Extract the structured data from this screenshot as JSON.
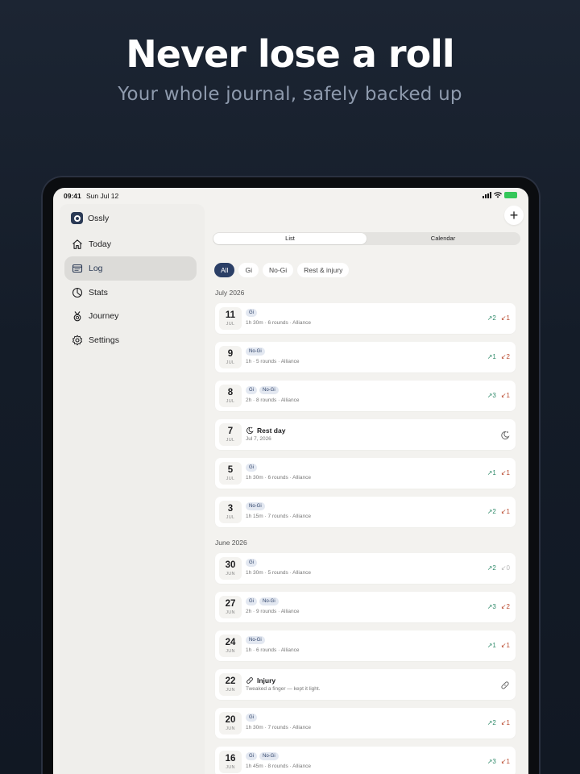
{
  "hero": {
    "title": "Never lose a roll",
    "subtitle": "Your whole journal, safely backed up"
  },
  "status_bar": {
    "time": "09:41",
    "date": "Sun Jul 12",
    "battery_icon": "battery-icon",
    "wifi_icon": "wifi-icon",
    "signal_icon": "signal-icon"
  },
  "sidebar": {
    "app_name": "Ossly",
    "items": [
      {
        "label": "Today",
        "icon": "home-icon",
        "active": false
      },
      {
        "label": "Log",
        "icon": "log-icon",
        "active": true
      },
      {
        "label": "Stats",
        "icon": "pie-chart-icon",
        "active": false
      },
      {
        "label": "Journey",
        "icon": "medal-icon",
        "active": false
      },
      {
        "label": "Settings",
        "icon": "gear-icon",
        "active": false
      }
    ]
  },
  "toolbar": {
    "add_icon": "plus-icon",
    "add_label": "+"
  },
  "view_toggle": {
    "options": [
      "List",
      "Calendar"
    ],
    "selected": "List"
  },
  "filters": {
    "options": [
      "All",
      "Gi",
      "No-Gi",
      "Rest & injury"
    ],
    "selected": "All"
  },
  "months": [
    {
      "label": "July 2026",
      "entries": [
        {
          "day": "11",
          "month": "JUL",
          "tags": [
            "Gi"
          ],
          "meta": "1h 30m · 6 rounds · Alliance",
          "up": "2",
          "down": "1"
        },
        {
          "day": "9",
          "month": "JUL",
          "tags": [
            "No-Gi"
          ],
          "meta": "1h · 5 rounds · Alliance",
          "up": "1",
          "down": "2"
        },
        {
          "day": "8",
          "month": "JUL",
          "tags": [
            "Gi",
            "No-Gi"
          ],
          "meta": "2h · 8 rounds · Alliance",
          "up": "3",
          "down": "1"
        },
        {
          "day": "7",
          "month": "JUL",
          "kind": "rest",
          "title": "Rest day",
          "meta": "Jul 7, 2026",
          "icon": "moon-icon"
        },
        {
          "day": "5",
          "month": "JUL",
          "tags": [
            "Gi"
          ],
          "meta": "1h 30m · 6 rounds · Alliance",
          "up": "1",
          "down": "1"
        },
        {
          "day": "3",
          "month": "JUL",
          "tags": [
            "No-Gi"
          ],
          "meta": "1h 15m · 7 rounds · Alliance",
          "up": "2",
          "down": "1"
        }
      ]
    },
    {
      "label": "June 2026",
      "entries": [
        {
          "day": "30",
          "month": "JUN",
          "tags": [
            "Gi"
          ],
          "meta": "1h 30m · 5 rounds · Alliance",
          "up": "2",
          "down": "0"
        },
        {
          "day": "27",
          "month": "JUN",
          "tags": [
            "Gi",
            "No-Gi"
          ],
          "meta": "2h · 9 rounds · Alliance",
          "up": "3",
          "down": "2"
        },
        {
          "day": "24",
          "month": "JUN",
          "tags": [
            "No-Gi"
          ],
          "meta": "1h · 6 rounds · Alliance",
          "up": "1",
          "down": "1"
        },
        {
          "day": "22",
          "month": "JUN",
          "kind": "injury",
          "title": "Injury",
          "meta": "Tweaked a finger — kept it light.",
          "icon": "bandage-icon"
        },
        {
          "day": "20",
          "month": "JUN",
          "tags": [
            "Gi"
          ],
          "meta": "1h 30m · 7 rounds · Alliance",
          "up": "2",
          "down": "1"
        },
        {
          "day": "16",
          "month": "JUN",
          "tags": [
            "Gi",
            "No-Gi"
          ],
          "meta": "1h 45m · 8 rounds · Alliance",
          "up": "3",
          "down": "1"
        }
      ]
    }
  ],
  "colors": {
    "accent": "#2b3f66",
    "up": "#2f8a6a",
    "down": "#b8462a"
  }
}
